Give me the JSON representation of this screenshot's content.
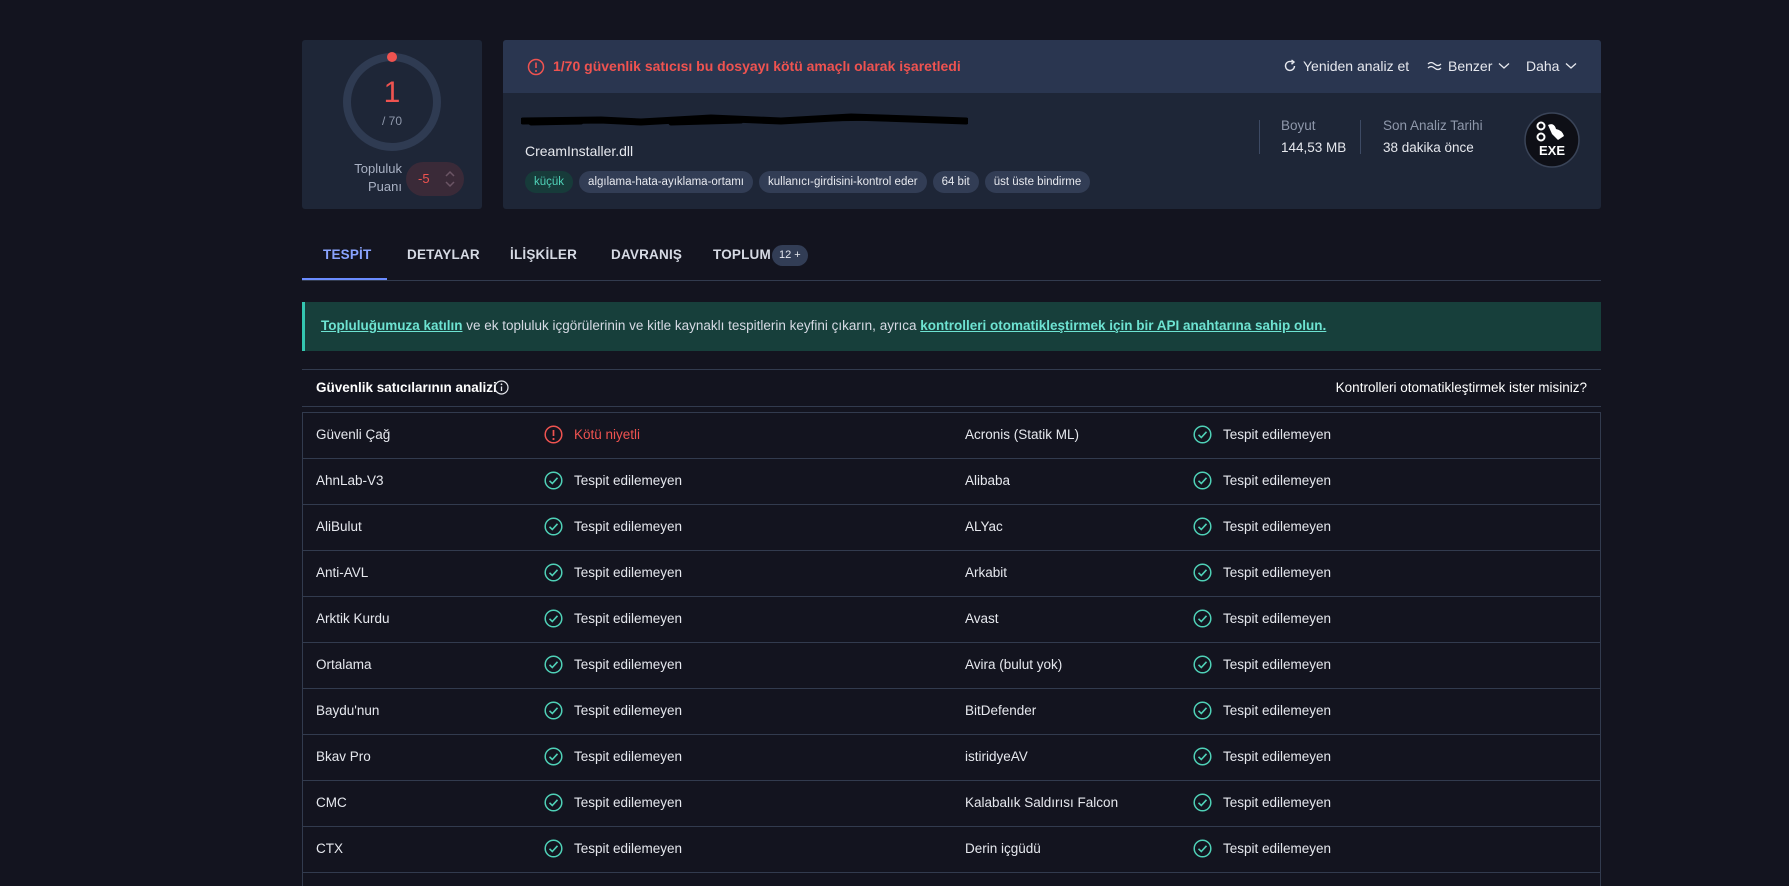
{
  "score": {
    "detections": "1",
    "total": "/ 70",
    "community_label_1": "Topluluk",
    "community_label_2": "Puanı",
    "community_value": "-5"
  },
  "header": {
    "alert": "1/70 güvenlik satıcısı bu dosyayı kötü amaçlı olarak işaretledi",
    "reanalyze": "Yeniden analiz et",
    "similar": "Benzer",
    "more": "Daha"
  },
  "file": {
    "name": "CreamInstaller.dll",
    "tags": [
      "küçük",
      "algılama-hata-ayıklama-ortamı",
      "kullanıcı-girdisini-kontrol eder",
      "64 bit",
      "üst üste bindirme"
    ],
    "size_label": "Boyut",
    "size_value": "144,53 MB",
    "last_label": "Son Analiz Tarihi",
    "last_value": "38 dakika önce",
    "type_icon": "EXE"
  },
  "tabs": [
    "TESPİT",
    "DETAYLAR",
    "İLİŞKİLER",
    "DAVRANIŞ",
    "TOPLUM"
  ],
  "tab_badge": "12 +",
  "banner": {
    "link1": "Topluluğumuza katılın",
    "middle": " ve ek topluluk içgörülerinin ve kitle kaynaklı tespitlerin keyfini çıkarın, ayrıca ",
    "link2": "kontrolleri otomatikleştirmek için bir API anahtarına sahip olun."
  },
  "section": {
    "title": "Güvenlik satıcılarının analizi",
    "right": "Kontrolleri otomatikleştirmek ister misiniz?"
  },
  "colors": {
    "malicious": "#ef5350",
    "clean": "#4fd1b7",
    "accent": "#6b8cff"
  },
  "vendors": [
    {
      "left": "Güvenli Çağ",
      "left_result": "Kötü niyetli",
      "left_bad": true,
      "right": "Acronis (Statik ML)",
      "right_result": "Tespit edilemeyen"
    },
    {
      "left": "AhnLab-V3",
      "left_result": "Tespit edilemeyen",
      "right": "Alibaba",
      "right_result": "Tespit edilemeyen"
    },
    {
      "left": "AliBulut",
      "left_result": "Tespit edilemeyen",
      "right": "ALYac",
      "right_result": "Tespit edilemeyen"
    },
    {
      "left": "Anti-AVL",
      "left_result": "Tespit edilemeyen",
      "right": "Arkabit",
      "right_result": "Tespit edilemeyen"
    },
    {
      "left": "Arktik Kurdu",
      "left_result": "Tespit edilemeyen",
      "right": "Avast",
      "right_result": "Tespit edilemeyen"
    },
    {
      "left": "Ortalama",
      "left_result": "Tespit edilemeyen",
      "right": "Avira (bulut yok)",
      "right_result": "Tespit edilemeyen"
    },
    {
      "left": "Baydu'nun",
      "left_result": "Tespit edilemeyen",
      "right": "BitDefender",
      "right_result": "Tespit edilemeyen"
    },
    {
      "left": "Bkav Pro",
      "left_result": "Tespit edilemeyen",
      "right": "istiridyeAV",
      "right_result": "Tespit edilemeyen"
    },
    {
      "left": "CMC",
      "left_result": "Tespit edilemeyen",
      "right": "Kalabalık Saldırısı Falcon",
      "right_result": "Tespit edilemeyen"
    },
    {
      "left": "CTX",
      "left_result": "Tespit edilemeyen",
      "right": "Derin içgüdü",
      "right_result": "Tespit edilemeyen"
    },
    {
      "left": "",
      "left_result": "",
      "right": "",
      "right_result": ""
    }
  ]
}
